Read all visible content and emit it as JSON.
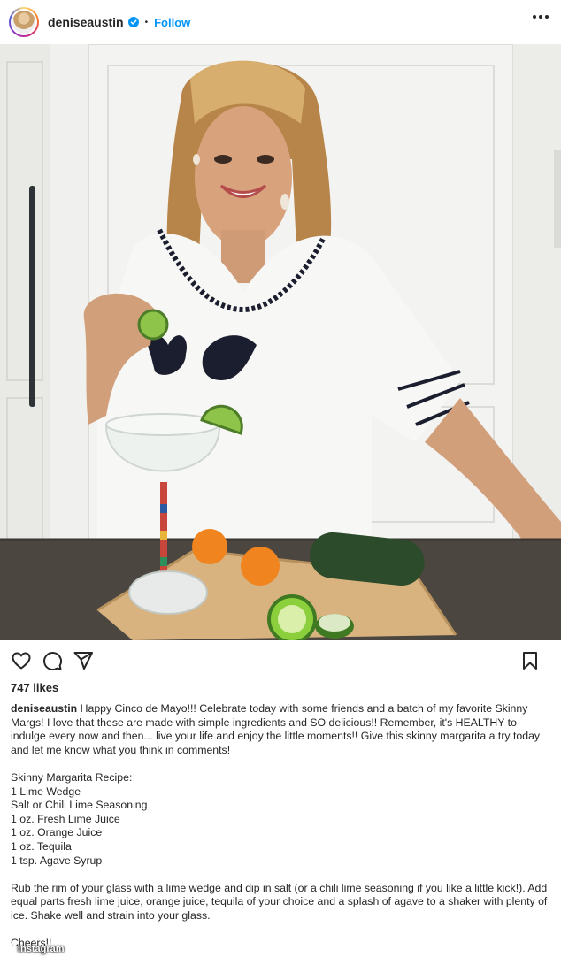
{
  "header": {
    "username": "deniseaustin",
    "separator": "•",
    "follow_label": "Follow"
  },
  "icons": {
    "verified": "verified-badge-icon",
    "more": "more-options-icon",
    "like": "heart-icon",
    "comment": "comment-icon",
    "share": "send-icon",
    "save": "bookmark-icon",
    "watermark": "camera-icon"
  },
  "colors": {
    "link_blue": "#0095f6",
    "text": "#262626"
  },
  "likes": "747 likes",
  "caption": {
    "username": "deniseaustin",
    "intro": "Happy Cinco de Mayo!!! Celebrate today with some friends and a batch of my favorite Skinny Margs! I love that these are made with simple ingredients and SO delicious!! Remember, it's HEALTHY to indulge every now and then... live your life and enjoy the little moments!! Give this skinny margarita a try today and let me know what you think in comments!",
    "recipe_title": "Skinny Margarita Recipe:",
    "ingredients": [
      "1 Lime Wedge",
      "Salt or Chili Lime Seasoning",
      "1 oz. Fresh Lime Juice",
      "1 oz. Orange Juice",
      "1 oz. Tequila",
      "1 tsp. Agave Syrup"
    ],
    "instructions": "Rub the rim of your glass with a lime wedge and dip in salt (or a chili lime seasoning if you like a little kick!). Add equal parts fresh lime juice, orange juice, tequila of your choice and a splash of agave to a shaker with plenty of ice. Shake well and strain into your glass.",
    "signoff": "Cheers!!"
  },
  "watermark": "Instagram"
}
